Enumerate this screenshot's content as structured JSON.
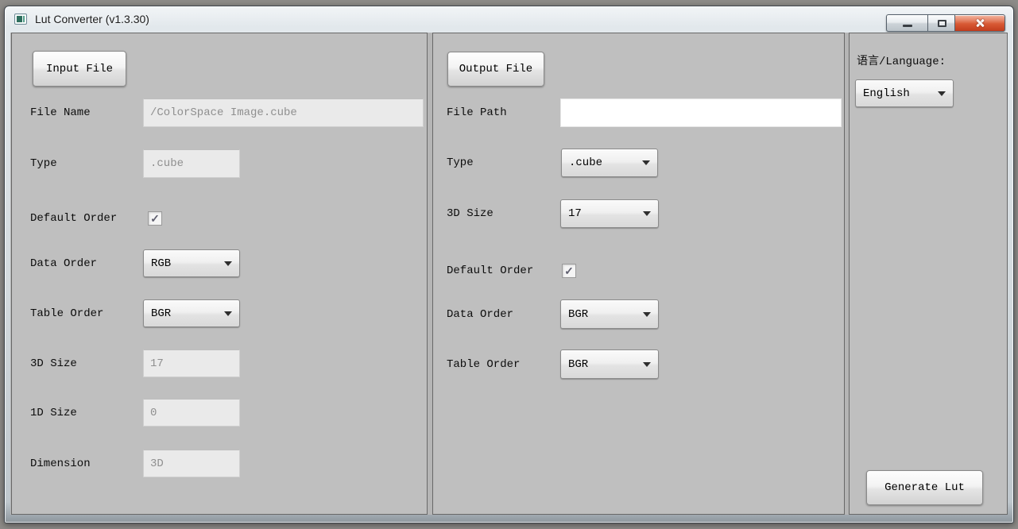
{
  "titlebar": {
    "title": "Lut Converter (v1.3.30)"
  },
  "icons": {
    "app_icon": "image-icon",
    "checkmark": "✓",
    "dropdown_arrow": "triangle-down",
    "minimize": "bar",
    "maximize": "square",
    "close": "x"
  },
  "colors": {
    "client_bg": "#bfbfbf",
    "panel_border": "#686868",
    "close_button_red": "#c23d1d",
    "disabled_field_bg": "#eaeaea",
    "disabled_field_text": "#8f8f8f"
  },
  "input_panel": {
    "header_button": "Input File",
    "file_name": {
      "label": "File Name",
      "value": "/ColorSpace Image.cube",
      "disabled": true
    },
    "type": {
      "label": "Type",
      "value": ".cube",
      "disabled": true
    },
    "default_order": {
      "label": "Default Order",
      "checked": true
    },
    "data_order": {
      "label": "Data Order",
      "value": "RGB"
    },
    "table_order": {
      "label": "Table Order",
      "value": "BGR"
    },
    "size_3d": {
      "label": "3D Size",
      "value": "17",
      "disabled": true
    },
    "size_1d": {
      "label": "1D Size",
      "value": "0",
      "disabled": true
    },
    "dimension": {
      "label": "Dimension",
      "value": "3D",
      "disabled": true
    }
  },
  "output_panel": {
    "header_button": "Output File",
    "file_path": {
      "label": "File Path",
      "value": ""
    },
    "type": {
      "label": "Type",
      "value": ".cube"
    },
    "size_3d": {
      "label": "3D Size",
      "value": "17"
    },
    "default_order": {
      "label": "Default Order",
      "checked": true
    },
    "data_order": {
      "label": "Data Order",
      "value": "BGR"
    },
    "table_order": {
      "label": "Table Order",
      "value": "BGR"
    }
  },
  "language_panel": {
    "label": "语言/Language:",
    "selected": "English",
    "generate_button": "Generate Lut"
  }
}
